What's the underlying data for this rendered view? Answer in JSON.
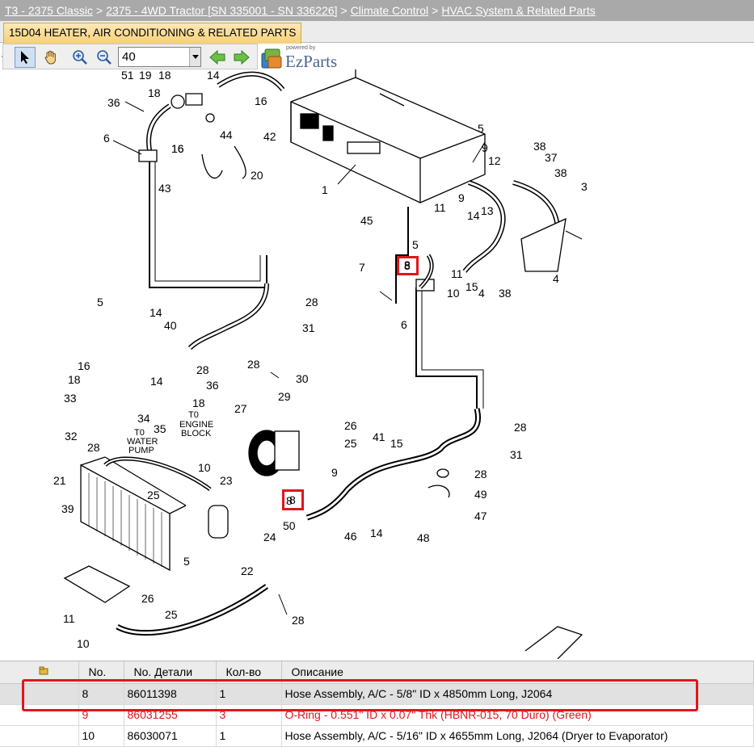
{
  "breadcrumb": {
    "items": [
      "T3 - 2375 Classic",
      "2375 - 4WD Tractor [SN 335001 - SN 336226]",
      "Climate Control",
      "HVAC System & Related Parts"
    ],
    "separator": ">"
  },
  "tab": {
    "label": "15D04 HEATER, AIR CONDITIONING & RELATED PARTS"
  },
  "toolbar": {
    "tools": [
      "pointer-tool",
      "pan-tool",
      "zoom-in",
      "zoom-out"
    ],
    "zoom_value": "40",
    "nav": [
      "back-arrow",
      "forward-arrow"
    ]
  },
  "logo": {
    "powered": "powered by",
    "brand": "EzParts"
  },
  "diagram": {
    "callouts": [
      "51",
      "19",
      "18",
      "14",
      "36",
      "18",
      "16",
      "16",
      "42",
      "44",
      "6",
      "16",
      "5",
      "9",
      "38",
      "37",
      "38",
      "12",
      "3",
      "1",
      "20",
      "43",
      "11",
      "9",
      "13",
      "45",
      "14",
      "5",
      "8",
      "7",
      "11",
      "15",
      "4",
      "4",
      "38",
      "10",
      "6",
      "28",
      "5",
      "14",
      "40",
      "31",
      "28",
      "28",
      "16",
      "18",
      "14",
      "36",
      "33",
      "18",
      "34",
      "35",
      "30",
      "29",
      "26",
      "27",
      "25",
      "32",
      "28",
      "9",
      "28",
      "15",
      "41",
      "10",
      "23",
      "31",
      "21",
      "25",
      "28",
      "49",
      "39",
      "8",
      "24",
      "50",
      "47",
      "5",
      "46",
      "14",
      "48",
      "22",
      "28",
      "26",
      "11",
      "25",
      "10"
    ],
    "engine_label": [
      "T0",
      "ENGINE",
      "BLOCK"
    ],
    "pump_label": [
      "T0",
      "WATER",
      "PUMP"
    ],
    "highlight_callout": "8"
  },
  "table": {
    "headers": [
      "No.",
      "No. Детали",
      "Кол-во",
      "Описание"
    ],
    "rows": [
      {
        "no": "8",
        "part": "86011398",
        "qty": "1",
        "desc": "Hose Assembly, A/C - 5/8\" ID x 4850mm Long, J2064",
        "state": "selected"
      },
      {
        "no": "9",
        "part": "86031255",
        "qty": "3",
        "desc": "O-Ring - 0.551\" ID x 0.07\" Thk (HBNR-015, 70 Duro) (Green)",
        "state": "red"
      },
      {
        "no": "10",
        "part": "86030071",
        "qty": "1",
        "desc": "Hose Assembly, A/C - 5/16\" ID x 4655mm Long, J2064 (Dryer to Evaporator)",
        "state": "normal"
      }
    ]
  },
  "colors": {
    "highlight": "#e0161d",
    "breadcrumb_bg": "#a9a9a9",
    "tab_bg": "#f6d07a"
  }
}
